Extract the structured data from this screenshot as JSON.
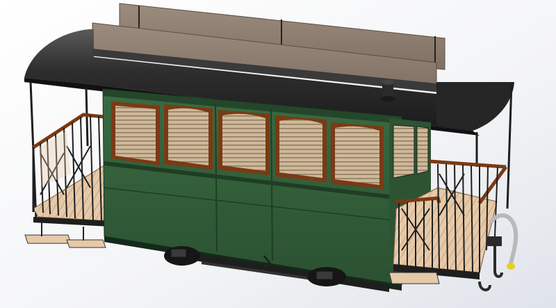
{
  "scene": {
    "subject": "tram-coach-3d-render",
    "colors": {
      "background_light": "#ffffff",
      "background_shade": "#dfe3ea",
      "body_green": "#2f5a36",
      "body_green_dark": "#244a2b",
      "body_green_light": "#3b6b42",
      "roof": "#2a2a2a",
      "roof_highlight": "#5a5a5a",
      "sign_board": "#8a7a6c",
      "window_frame": "#7a3a14",
      "window_interior": "#c9b79a",
      "deck_wood": "#e6c9a8",
      "railing_wood": "#7a3a14",
      "iron": "#1e1e1e",
      "coupling_yellow": "#e8d020",
      "hose_grey": "#b9b9b9"
    }
  }
}
